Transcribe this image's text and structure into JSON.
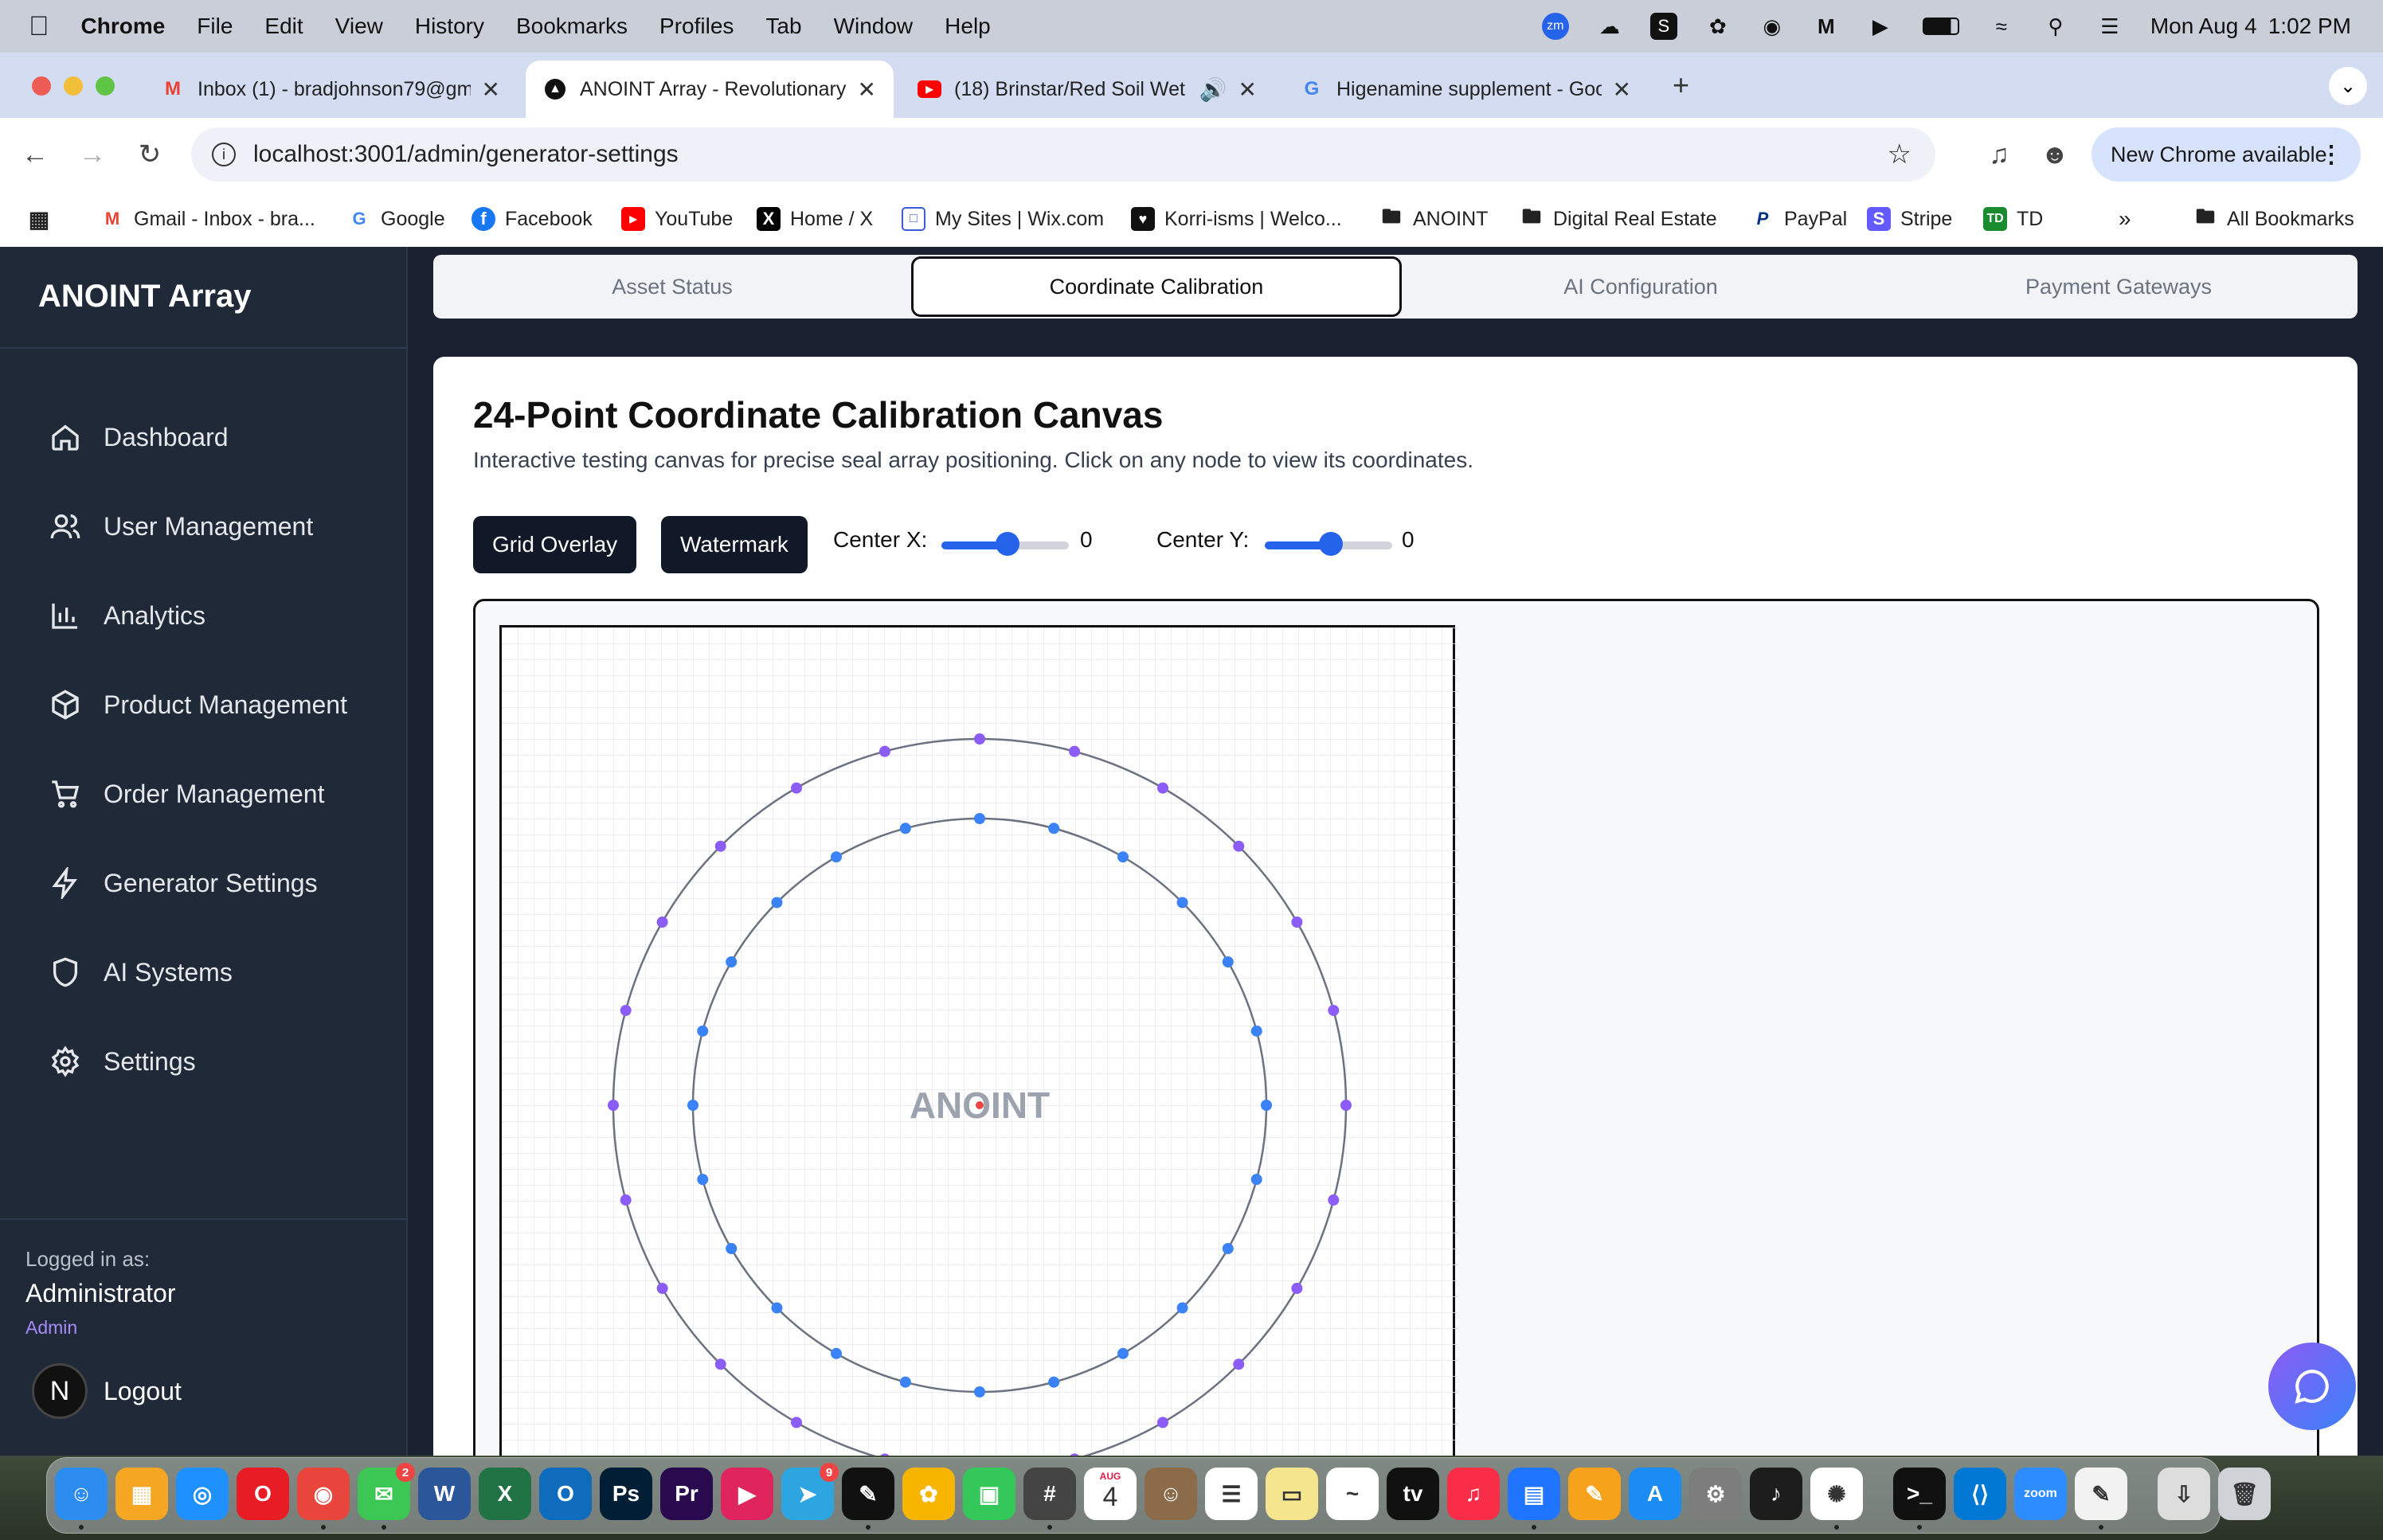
{
  "menubar": {
    "app": "Chrome",
    "items": [
      "File",
      "Edit",
      "View",
      "History",
      "Bookmarks",
      "Profiles",
      "Tab",
      "Window",
      "Help"
    ],
    "date": "Mon Aug 4",
    "time": "1:02 PM",
    "zm_badge": "zm"
  },
  "tabs": [
    {
      "icon": "gmail-icon",
      "title": "Inbox (1) - bradjohnson79@gm"
    },
    {
      "icon": "anoint-icon",
      "title": "ANOINT Array - Revolutionary"
    },
    {
      "icon": "youtube-icon",
      "title": "(18) Brinstar/Red Soil Wet"
    },
    {
      "icon": "google-icon",
      "title": "Higenamine supplement - Goo"
    }
  ],
  "address": {
    "url": "localhost:3001/admin/generator-settings",
    "update_label": "New Chrome available"
  },
  "bookmarks": [
    {
      "icon": "gmail-icon",
      "label": "Gmail - Inbox - bra..."
    },
    {
      "icon": "google-icon",
      "label": "Google"
    },
    {
      "icon": "facebook-icon",
      "label": "Facebook"
    },
    {
      "icon": "youtube-icon",
      "label": "YouTube"
    },
    {
      "icon": "x-icon",
      "label": "Home / X"
    },
    {
      "icon": "wix-icon",
      "label": "My Sites | Wix.com"
    },
    {
      "icon": "heart-icon",
      "label": "Korri-isms | Welco..."
    },
    {
      "icon": "folder-icon",
      "label": "ANOINT"
    },
    {
      "icon": "folder-icon",
      "label": "Digital Real Estate"
    },
    {
      "icon": "paypal-icon",
      "label": "PayPal"
    },
    {
      "icon": "stripe-icon",
      "label": "Stripe"
    },
    {
      "icon": "td-icon",
      "label": "TD"
    },
    {
      "icon": "folder-icon",
      "label": "All Bookmarks"
    }
  ],
  "sidebar": {
    "brand": "ANOINT Array",
    "items": [
      {
        "icon": "home-icon",
        "label": "Dashboard"
      },
      {
        "icon": "users-icon",
        "label": "User Management"
      },
      {
        "icon": "chart-icon",
        "label": "Analytics"
      },
      {
        "icon": "box-icon",
        "label": "Product Management"
      },
      {
        "icon": "cart-icon",
        "label": "Order Management"
      },
      {
        "icon": "bolt-icon",
        "label": "Generator Settings"
      },
      {
        "icon": "shield-icon",
        "label": "AI Systems"
      },
      {
        "icon": "gear-icon",
        "label": "Settings"
      }
    ],
    "logged_in_label": "Logged in as:",
    "user_name": "Administrator",
    "user_role": "Admin",
    "avatar_letter": "N",
    "logout_label": "Logout"
  },
  "main": {
    "tabs": [
      "Asset Status",
      "Coordinate Calibration",
      "AI Configuration",
      "Payment Gateways"
    ],
    "active_tab": "Coordinate Calibration",
    "title": "24-Point Coordinate Calibration Canvas",
    "subtitle": "Interactive testing canvas for precise seal array positioning. Click on any node to view its coordinates.",
    "grid_button": "Grid Overlay",
    "watermark_button": "Watermark",
    "center_x_label": "Center X:",
    "center_x_value": "0",
    "center_y_label": "Center Y:",
    "center_y_value": "0",
    "watermark_text": "ANOINT",
    "outer_ring_nodes": 24,
    "inner_ring_nodes": 24,
    "colors": {
      "outer_node": "#8b5cf6",
      "inner_node": "#3b82f6",
      "center_dot": "#ef4444"
    }
  },
  "dock": {
    "apps": [
      "Finder",
      "Launchpad",
      "Safari",
      "Opera",
      "Chrome",
      "Messages",
      "Word",
      "Excel",
      "Outlook",
      "Photoshop",
      "Premiere",
      "Infuse",
      "Telegram",
      "Kindle",
      "Photos",
      "FaceTime",
      "Calculator",
      "Calendar",
      "Contacts",
      "Reminders",
      "Notes",
      "Freeform",
      "TV",
      "Music",
      "Keynote",
      "Pages",
      "App Store",
      "System Settings",
      "Audacity",
      "ChatGPT",
      "Terminal",
      "VS Code",
      "Zoom",
      "TextEdit",
      "Downloads",
      "Trash"
    ],
    "calendar_month": "AUG",
    "calendar_day": "4",
    "messages_badge": "2",
    "telegram_badge": "9"
  }
}
